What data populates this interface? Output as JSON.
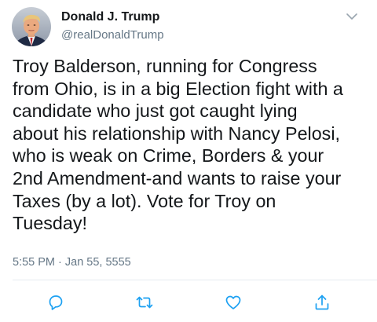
{
  "author": {
    "name": "Donald J. Trump",
    "handle": "@realDonaldTrump"
  },
  "tweet": {
    "text": "Troy Balderson, running for Congress\nfrom Ohio, is in a big Election fight with a\ncandidate who just got caught lying\nabout his relationship with Nancy Pelosi,\nwho is weak on Crime, Borders & your\n2nd Amendment-and wants to raise your\nTaxes (by a lot). Vote for Troy on\nTuesday!",
    "timestamp": "5:55 PM · Jan 55, 5555"
  },
  "icons": {
    "menu": "chevron-down-icon",
    "reply": "reply-icon",
    "retweet": "retweet-icon",
    "like": "heart-icon",
    "share": "share-icon"
  },
  "colors": {
    "text": "#14171a",
    "secondary": "#657786",
    "action_icon": "#1da1f2",
    "divider": "#e6ecf0"
  }
}
